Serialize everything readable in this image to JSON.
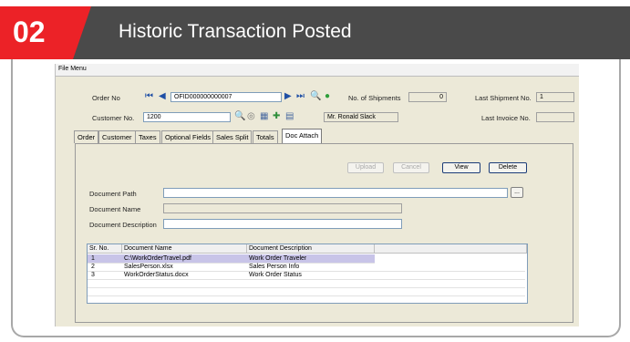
{
  "banner": {
    "step": "02",
    "title": "Historic Transaction Posted"
  },
  "app": {
    "menu": "File  Menu",
    "order_no_label": "Order No",
    "order_no_value": "OFID000000000007",
    "shipments_label": "No. of Shipments",
    "shipments_value": "0",
    "last_shipment_label": "Last Shipment No.",
    "last_shipment_value": "1",
    "customer_no_label": "Customer No.",
    "customer_no_value": "1200",
    "customer_name": "Mr. Ronald Slack",
    "last_invoice_label": "Last Invoice No.",
    "last_invoice_value": ""
  },
  "tabs": [
    "Order",
    "Customer",
    "Taxes",
    "Optional Fields",
    "Sales Split",
    "Totals",
    "Doc Attach"
  ],
  "buttons": {
    "upload": "Upload",
    "cancel": "Cancel",
    "view": "View",
    "delete": "Delete",
    "browse": "..."
  },
  "form": {
    "path_label": "Document Path",
    "name_label": "Document Name",
    "desc_label": "Document Description"
  },
  "grid": {
    "headers": [
      "Sr. No.",
      "Document Name",
      "Document Description"
    ],
    "rows": [
      {
        "no": "1",
        "name": "C:\\WorkOrderTravel.pdf",
        "desc": "Work Order Traveler"
      },
      {
        "no": "2",
        "name": "SalesPerson.xlsx",
        "desc": "Sales Person Info"
      },
      {
        "no": "3",
        "name": "WorkOrderStatus.docx",
        "desc": "Work Order Status"
      }
    ]
  }
}
